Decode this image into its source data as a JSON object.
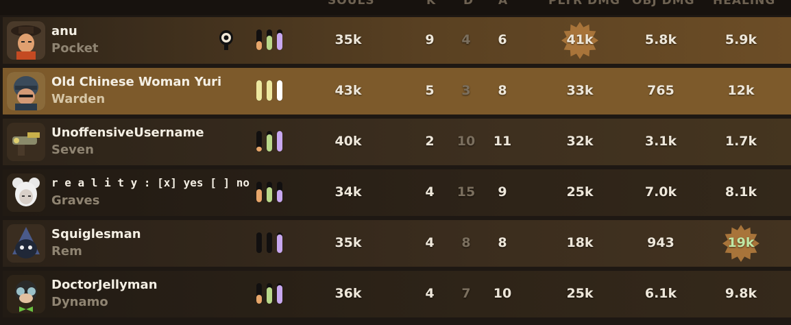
{
  "header": {
    "cols": {
      "souls": "SOULS",
      "k": "K",
      "d": "D",
      "a": "A",
      "player_dmg": "PLYR DMG",
      "obj_dmg": "OBJ DMG",
      "healing": "HEALING"
    }
  },
  "players": [
    {
      "name": "anu",
      "hero": "Pocket",
      "souls": "35k",
      "k": "9",
      "d": "4",
      "a": "6",
      "player_dmg": "41k",
      "obj_dmg": "5.8k",
      "healing": "5.9k",
      "bars": [
        0.45,
        0.7,
        0.85
      ],
      "has_eye": true,
      "top_player_dmg": true,
      "top_healing": false
    },
    {
      "name": "Old Chinese Woman Yuri",
      "hero": "Warden",
      "souls": "43k",
      "k": "5",
      "d": "3",
      "a": "8",
      "player_dmg": "33k",
      "obj_dmg": "765",
      "healing": "12k",
      "bars": [
        1.0,
        1.0,
        1.0
      ],
      "has_eye": false,
      "top_player_dmg": false,
      "top_healing": false
    },
    {
      "name": "UnoffensiveUsername",
      "hero": "Seven",
      "souls": "40k",
      "k": "2",
      "d": "10",
      "a": "11",
      "player_dmg": "32k",
      "obj_dmg": "3.1k",
      "healing": "1.7k",
      "bars": [
        0.25,
        0.85,
        1.0
      ],
      "has_eye": false,
      "top_player_dmg": false,
      "top_healing": false
    },
    {
      "name": "r e a l i t y : [x] yes [ ] no",
      "hero": "Graves",
      "souls": "34k",
      "k": "4",
      "d": "15",
      "a": "9",
      "player_dmg": "25k",
      "obj_dmg": "7.0k",
      "healing": "8.1k",
      "bars": [
        0.65,
        0.75,
        0.6
      ],
      "has_eye": false,
      "top_player_dmg": false,
      "top_healing": false
    },
    {
      "name": "Squiglesman",
      "hero": "Rem",
      "souls": "35k",
      "k": "4",
      "d": "8",
      "a": "8",
      "player_dmg": "18k",
      "obj_dmg": "943",
      "healing": "19k",
      "bars": [
        0.0,
        0.0,
        0.9
      ],
      "has_eye": false,
      "top_player_dmg": false,
      "top_healing": true
    },
    {
      "name": "DoctorJellyman",
      "hero": "Dynamo",
      "souls": "36k",
      "k": "4",
      "d": "7",
      "a": "10",
      "player_dmg": "25k",
      "obj_dmg": "6.1k",
      "healing": "9.8k",
      "bars": [
        0.45,
        0.8,
        0.9
      ],
      "has_eye": false,
      "top_player_dmg": false,
      "top_healing": false
    }
  ],
  "colors": {
    "bar_souls": "#e7a66a",
    "bar_dmg": "#b9d98a",
    "bar_heal": "#c8a8f0",
    "bar_full": "#ece8a0",
    "burst": "#a8743a",
    "burst_heal_text": "#bfe8a6"
  }
}
